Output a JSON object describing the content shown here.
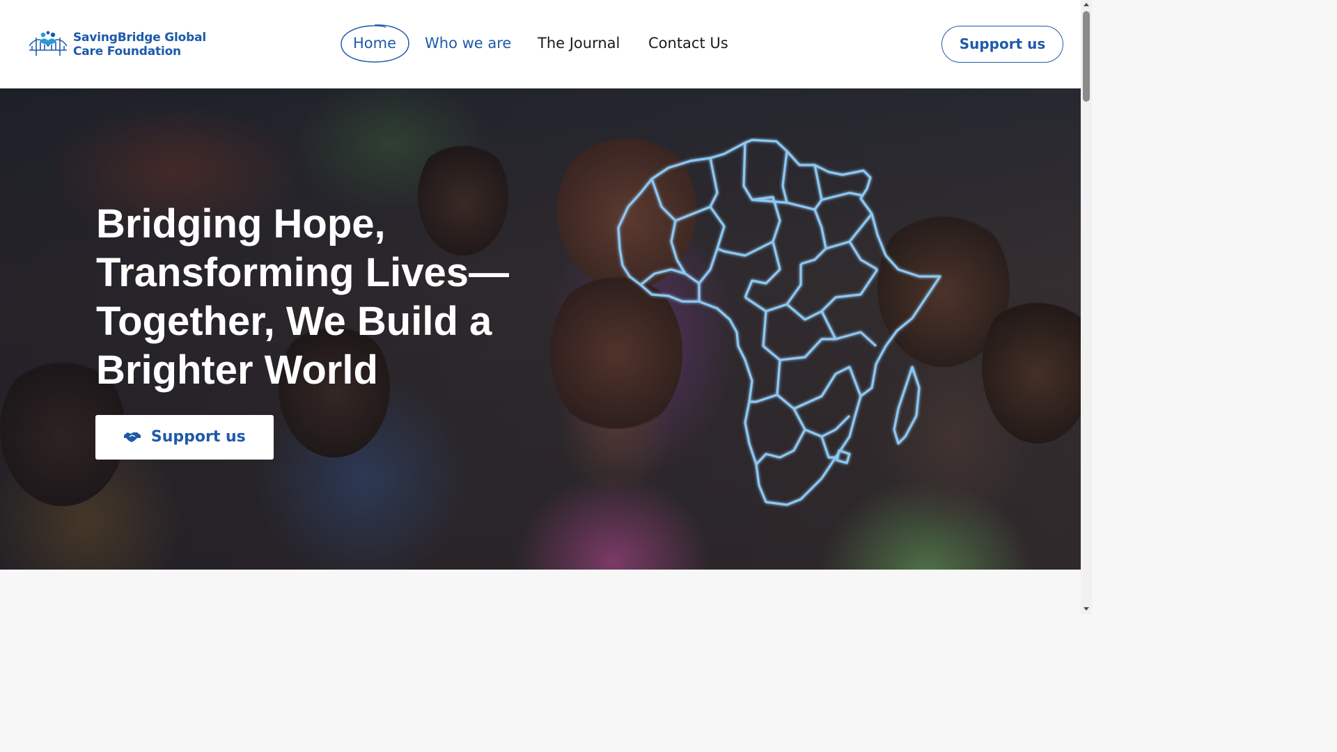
{
  "brand": {
    "name_line1": "SavingBridge Global",
    "name_line2": "Care Foundation",
    "logo_icon": "bridge-with-people-logo"
  },
  "nav": {
    "items": [
      {
        "label": "Home",
        "active": true
      },
      {
        "label": "Who we are",
        "active": false
      },
      {
        "label": "The Journal",
        "active": false
      },
      {
        "label": "Contact Us",
        "active": false
      }
    ]
  },
  "header": {
    "cta_label": "Support us"
  },
  "hero": {
    "title": "Bridging Hope, Transforming Lives—Together, We Build a Brighter World",
    "cta_label": "Support us",
    "cta_icon": "handshake-icon",
    "overlay_graphic": "africa-map-outline"
  },
  "colors": {
    "brand_blue": "#1e5aa8",
    "map_outline": "#8ec7f2",
    "white": "#ffffff"
  }
}
